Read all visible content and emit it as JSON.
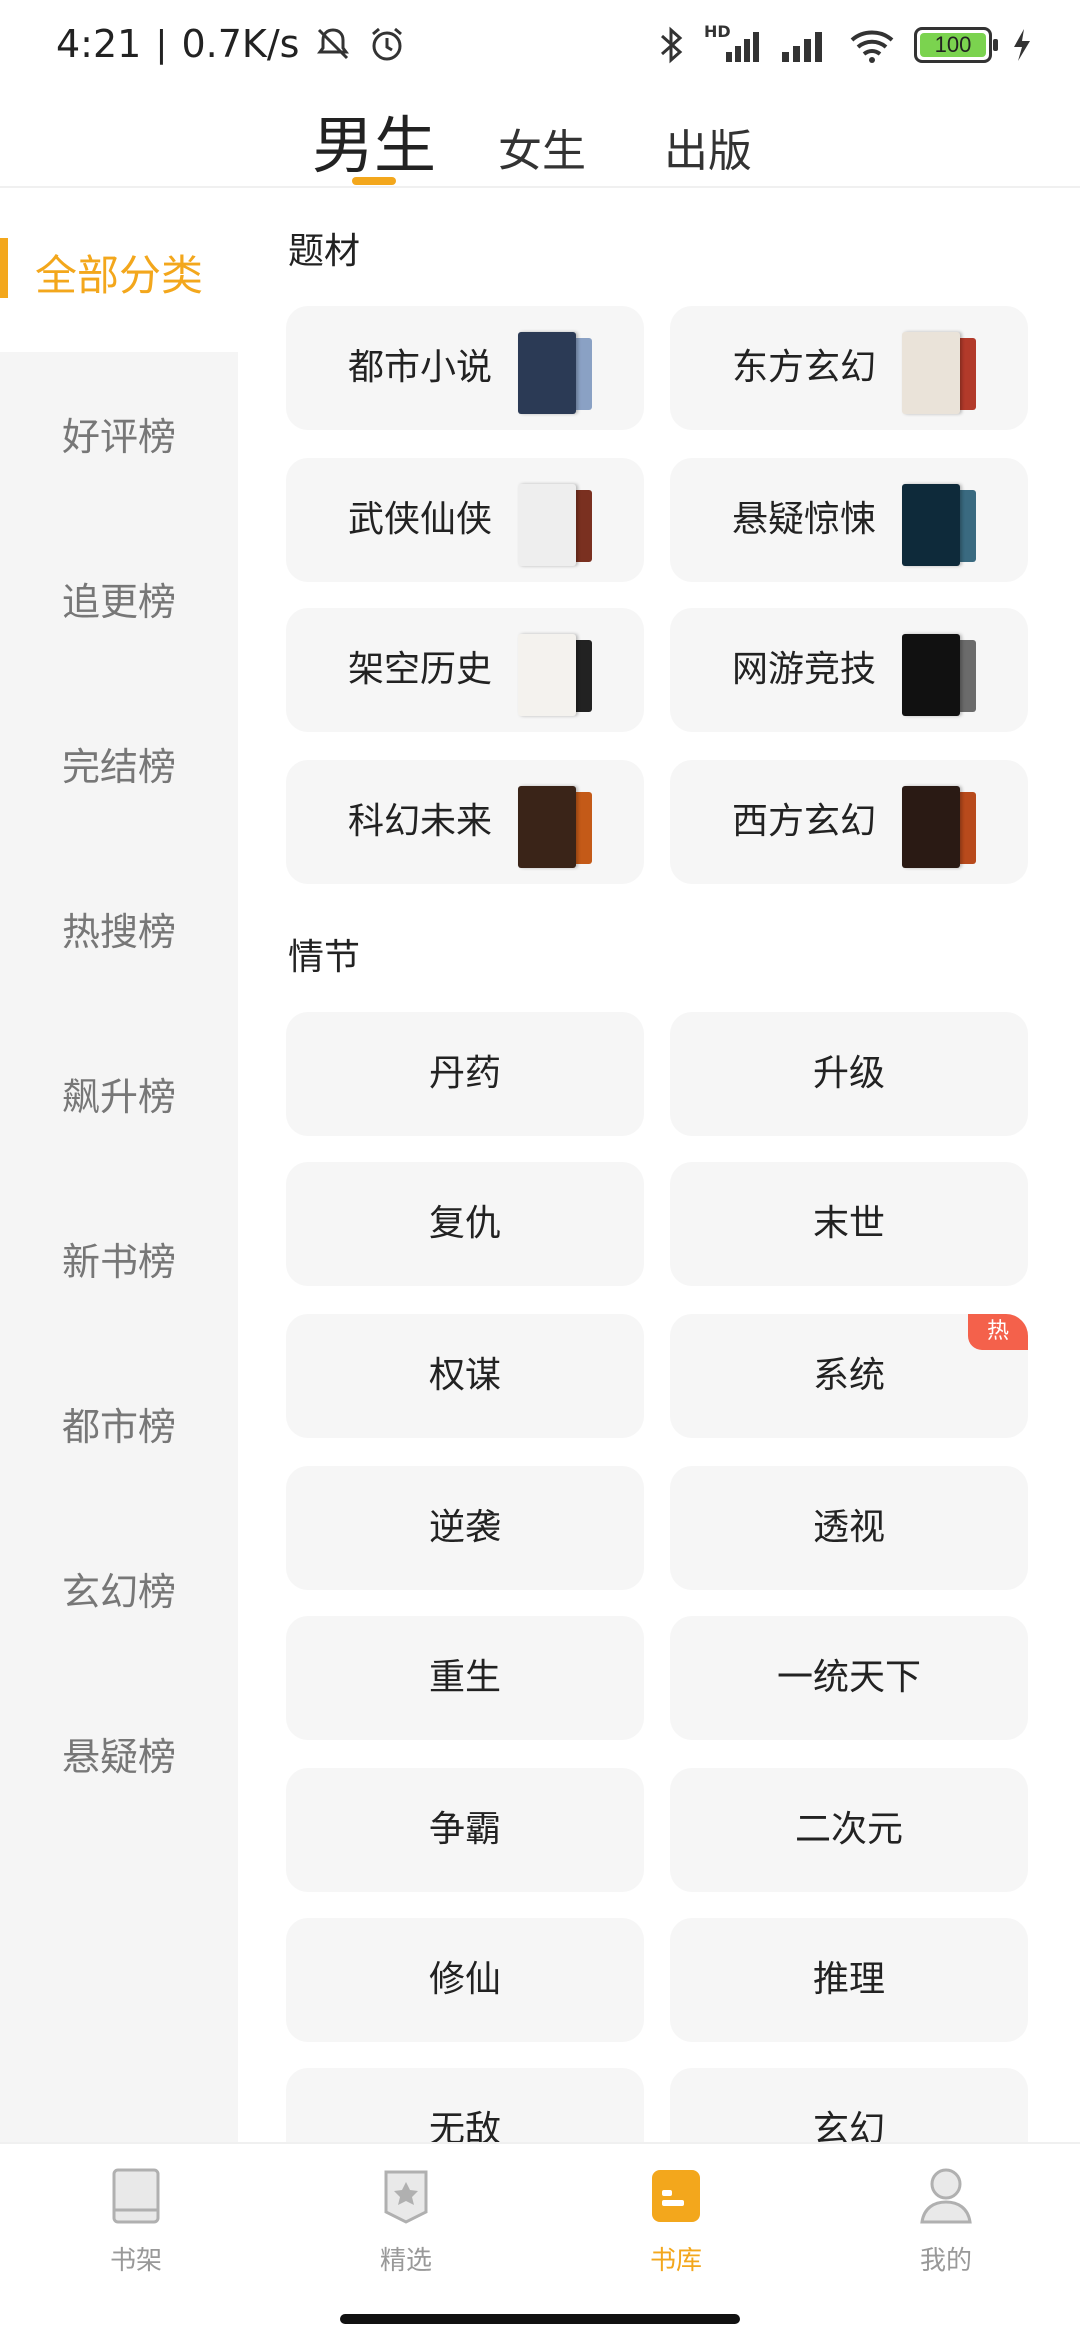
{
  "status_bar": {
    "time": "4:21",
    "separator": "|",
    "net_speed": "0.7K/s",
    "hd_label": "HD",
    "battery": "100"
  },
  "top_tabs": [
    {
      "label": "男生",
      "active": true
    },
    {
      "label": "女生",
      "active": false
    },
    {
      "label": "出版",
      "active": false
    }
  ],
  "sidebar": {
    "items": [
      {
        "label": "全部分类",
        "active": true
      },
      {
        "label": "好评榜"
      },
      {
        "label": "追更榜"
      },
      {
        "label": "完结榜"
      },
      {
        "label": "热搜榜"
      },
      {
        "label": "飙升榜"
      },
      {
        "label": "新书榜"
      },
      {
        "label": "都市榜"
      },
      {
        "label": "玄幻榜"
      },
      {
        "label": "悬疑榜"
      }
    ]
  },
  "sections": {
    "theme_title": "题材",
    "themes": [
      {
        "label": "都市小说",
        "cover_colors": [
          "#2b3a55",
          "#8aa1c4"
        ]
      },
      {
        "label": "东方玄幻",
        "cover_colors": [
          "#eae3d9",
          "#b23a2a"
        ]
      },
      {
        "label": "武侠仙侠",
        "cover_colors": [
          "#eeeeee",
          "#7a3020"
        ]
      },
      {
        "label": "悬疑惊悚",
        "cover_colors": [
          "#0e2a3a",
          "#3a6a80"
        ]
      },
      {
        "label": "架空历史",
        "cover_colors": [
          "#f4f2ee",
          "#222222"
        ]
      },
      {
        "label": "网游竞技",
        "cover_colors": [
          "#111111",
          "#6b6b6b"
        ]
      },
      {
        "label": "科幻未来",
        "cover_colors": [
          "#3a2418",
          "#c45a18"
        ]
      },
      {
        "label": "西方玄幻",
        "cover_colors": [
          "#2a1a14",
          "#b84a1c"
        ]
      }
    ],
    "plot_title": "情节",
    "plots": [
      {
        "label": "丹药"
      },
      {
        "label": "升级"
      },
      {
        "label": "复仇"
      },
      {
        "label": "末世"
      },
      {
        "label": "权谋"
      },
      {
        "label": "系统",
        "badge": "热"
      },
      {
        "label": "逆袭"
      },
      {
        "label": "透视"
      },
      {
        "label": "重生"
      },
      {
        "label": "一统天下"
      },
      {
        "label": "争霸"
      },
      {
        "label": "二次元"
      },
      {
        "label": "修仙"
      },
      {
        "label": "推理"
      },
      {
        "label": "无敌"
      },
      {
        "label": "玄幻"
      }
    ]
  },
  "bottom_nav": [
    {
      "label": "书架",
      "icon": "bookshelf-icon"
    },
    {
      "label": "精选",
      "icon": "featured-icon"
    },
    {
      "label": "书库",
      "icon": "library-icon",
      "active": true
    },
    {
      "label": "我的",
      "icon": "profile-icon"
    }
  ],
  "colors": {
    "accent": "#f3a71c",
    "hot_badge": "#f4614b",
    "card_bg": "#f6f6f6",
    "sidebar_bg": "#f5f5f5"
  }
}
